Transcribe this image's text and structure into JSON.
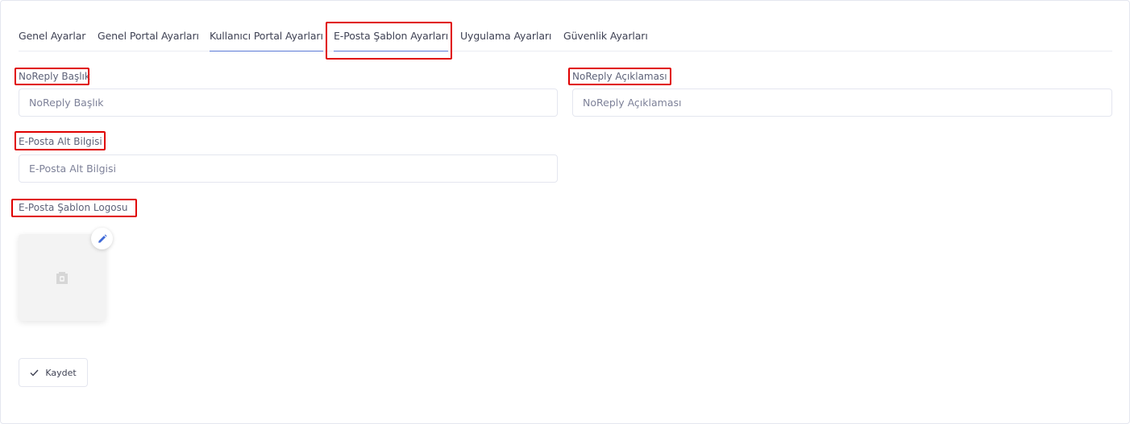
{
  "tabs": [
    {
      "label": "Genel Ayarlar"
    },
    {
      "label": "Genel Portal Ayarları"
    },
    {
      "label": "Kullanıcı Portal Ayarları"
    },
    {
      "label": "E-Posta Şablon Ayarları"
    },
    {
      "label": "Uygulama Ayarları"
    },
    {
      "label": "Güvenlik Ayarları"
    }
  ],
  "form": {
    "noreply_title": {
      "label": "NoReply Başlık",
      "placeholder": "NoReply Başlık",
      "value": ""
    },
    "noreply_description": {
      "label": "NoReply Açıklaması",
      "placeholder": "NoReply Açıklaması",
      "value": ""
    },
    "email_footer": {
      "label": "E-Posta Alt Bilgisi",
      "placeholder": "E-Posta Alt Bilgisi",
      "value": ""
    },
    "email_logo": {
      "label": "E-Posta Şablon Logosu",
      "icon": "image-placeholder-icon",
      "edit_icon": "pencil-icon"
    }
  },
  "actions": {
    "save_label": "Kaydet",
    "save_icon": "check-icon"
  },
  "colors": {
    "accent": "#5b7ad6",
    "highlight": "#e00000",
    "border": "#e4e6ef"
  }
}
